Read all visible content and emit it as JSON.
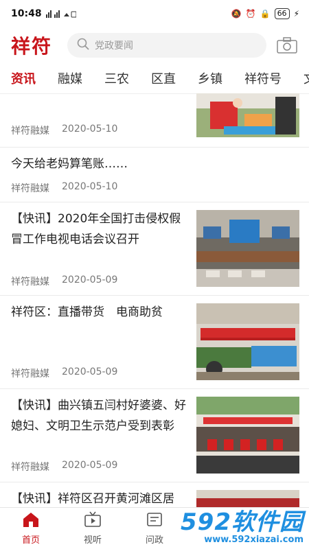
{
  "status": {
    "time": "10:48",
    "icons": "ᵢᵢ ⁴ᴳ",
    "battery": "66"
  },
  "header": {
    "logo": "祥符",
    "search_placeholder": "党政要闻"
  },
  "tabs": [
    "资讯",
    "融媒",
    "三农",
    "区直",
    "乡镇",
    "祥符号",
    "文化"
  ],
  "feed": [
    {
      "title": "",
      "source": "祥符融媒",
      "date": "2020-05-10"
    },
    {
      "title": "今天给老妈算笔账……",
      "source": "祥符融媒",
      "date": "2020-05-10"
    },
    {
      "title": "【快讯】2020年全国打击侵权假冒工作电视电话会议召开",
      "source": "祥符融媒",
      "date": "2020-05-09"
    },
    {
      "title": "祥符区：直播带货　电商助贫",
      "source": "祥符融媒",
      "date": "2020-05-09"
    },
    {
      "title": "【快讯】曲兴镇五闫村好婆婆、好媳妇、文明卫生示范户受到表彰",
      "source": "祥符融媒",
      "date": "2020-05-09"
    },
    {
      "title": "【快讯】祥符区召开黄河滩区居",
      "source": "",
      "date": ""
    }
  ],
  "bottom_nav": [
    "首页",
    "视听",
    "问政"
  ],
  "watermark": {
    "main": "592软件园",
    "url": "www.592xiazai.com"
  },
  "colors": {
    "accent": "#c8151b",
    "watermark": "#1f8fe0"
  }
}
